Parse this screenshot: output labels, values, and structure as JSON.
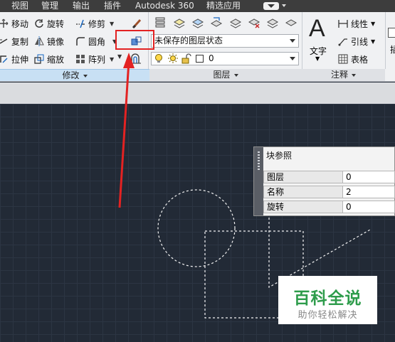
{
  "menubar": {
    "items": [
      "视图",
      "管理",
      "输出",
      "插件",
      "Autodesk 360",
      "精选应用"
    ]
  },
  "ribbon": {
    "modify": {
      "row1": [
        "移动",
        "旋转",
        "修剪"
      ],
      "row2": [
        "复制",
        "镜像",
        "圆角"
      ],
      "row3": [
        "拉伸",
        "缩放",
        "阵列"
      ],
      "panel_label": "修改"
    },
    "layers": {
      "state_dropdown": "未保存的图层状态",
      "layer_dropdown": "0",
      "panel_label": "图层"
    },
    "annotation": {
      "text_label": "文字",
      "linear_label": "线性",
      "leader_label": "引线",
      "table_label": "表格",
      "panel_label": "注释",
      "next_label": "插"
    },
    "highlight_color": "#e32222",
    "arrow_color": "#e32222"
  },
  "palette": {
    "title": "块参照",
    "rows": [
      {
        "name": "图层",
        "value": "0"
      },
      {
        "name": "名称",
        "value": "2"
      },
      {
        "name": "旋转",
        "value": "0"
      }
    ]
  },
  "watermark": {
    "title": "百科全说",
    "subtitle": "助你轻松解决",
    "color": "#2e9c4b"
  }
}
